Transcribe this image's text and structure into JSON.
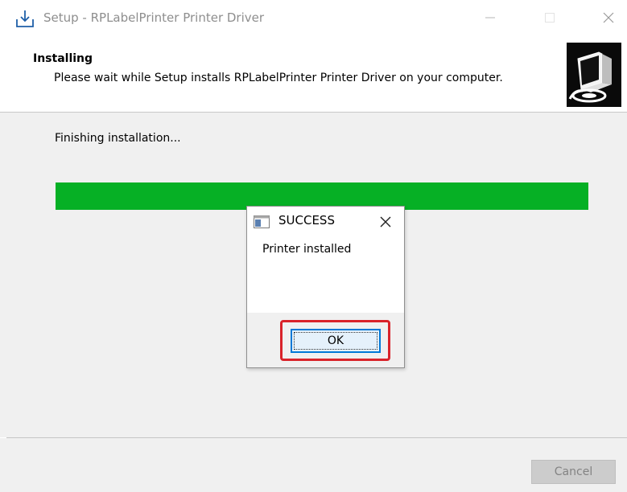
{
  "window": {
    "title": "Setup - RPLabelPrinter Printer Driver",
    "icon": "setup-installer-icon",
    "controls": [
      "minimize-icon",
      "maximize-icon",
      "close-icon"
    ]
  },
  "header": {
    "title": "Installing",
    "subtitle": "Please wait while Setup installs RPLabelPrinter Printer Driver on your computer.",
    "logo": "installer-computer-logo"
  },
  "content": {
    "status": "Finishing installation...",
    "progress": 1.0
  },
  "footer": {
    "cancel_label": "Cancel"
  },
  "dialog": {
    "title": "SUCCESS",
    "message": "Printer installed",
    "ok_label": "OK",
    "highlight_color": "#d9232a"
  },
  "colors": {
    "progress_fill": "#06b025",
    "content_bg": "#f0f0f0",
    "focus_blue": "#0078d7"
  }
}
